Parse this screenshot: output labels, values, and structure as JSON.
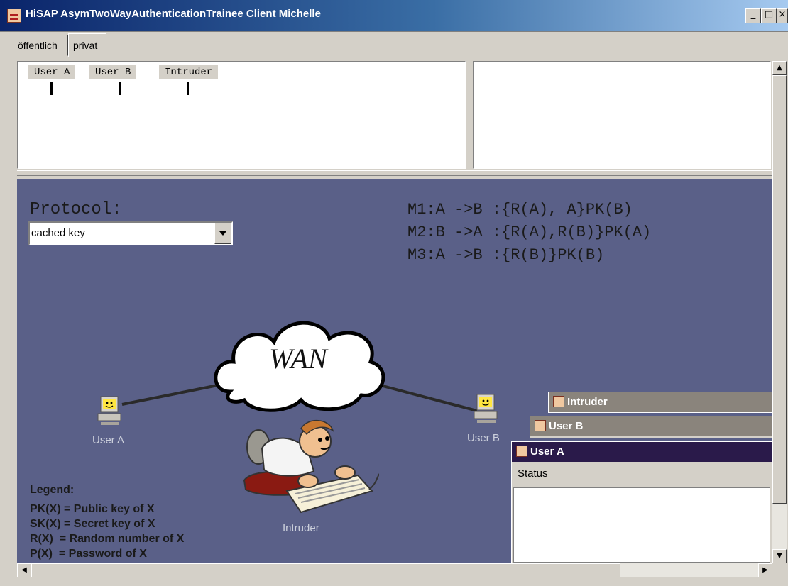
{
  "window": {
    "title": "HiSAP AsymTwoWayAuthenticationTrainee Client Michelle",
    "minimize": "_",
    "maximize": "□",
    "close": "×"
  },
  "tabs": [
    {
      "label": "öffentlich",
      "selected": false
    },
    {
      "label": "privat",
      "selected": true
    }
  ],
  "lanes": [
    "User A",
    "User B",
    "Intruder"
  ],
  "protocol": {
    "label": "Protocol:",
    "selected": "cached key",
    "messages": [
      "M1:A ->B :{R(A), A}PK(B)",
      "M2:B ->A :{R(A),R(B)}PK(A)",
      "M3:A ->B :{R(B)}PK(B)"
    ]
  },
  "network": {
    "cloud_label": "WAN",
    "user_a": "User A",
    "user_b": "User B",
    "intruder": "Intruder"
  },
  "legend": {
    "title": "Legend:",
    "items": [
      "PK(X) = Public key of X",
      "SK(X) = Secret key of X",
      "R(X)  = Random number of X",
      "P(X)  = Password of X"
    ]
  },
  "frames": {
    "intruder": "Intruder",
    "user_b": "User B",
    "user_a": "User A",
    "status_label": "Status"
  },
  "colors": {
    "canvas": "#5a6088",
    "active_frame": "#2a1a4a",
    "inactive_frame": "#8a847c"
  }
}
